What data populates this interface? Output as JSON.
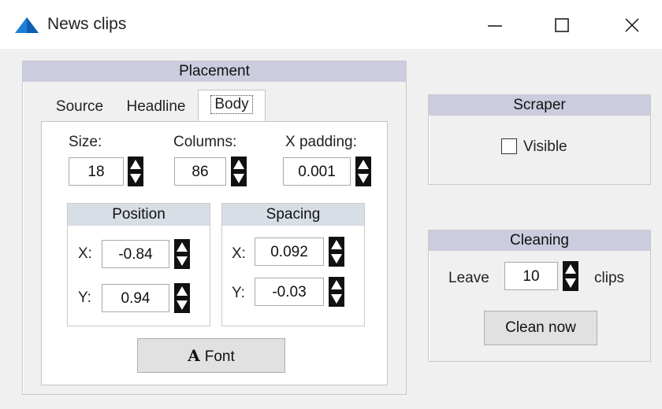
{
  "window": {
    "title": "News clips"
  },
  "placement": {
    "heading": "Placement",
    "tabs": [
      "Source",
      "Headline",
      "Body"
    ],
    "size": {
      "label": "Size:",
      "value": "18"
    },
    "columns": {
      "label": "Columns:",
      "value": "86"
    },
    "x_padding": {
      "label": "X padding:",
      "value": "0.001"
    },
    "position": {
      "heading": "Position",
      "x_label": "X:",
      "x_value": "-0.84",
      "y_label": "Y:",
      "y_value": "0.94"
    },
    "spacing": {
      "heading": "Spacing",
      "x_label": "X:",
      "x_value": "0.092",
      "y_label": "Y:",
      "y_value": "-0.03"
    },
    "font_button": {
      "icon_glyph": "A",
      "label": "Font"
    }
  },
  "scraper": {
    "heading": "Scraper",
    "visible_label": "Visible",
    "visible_checked": false
  },
  "cleaning": {
    "heading": "Cleaning",
    "leave_label": "Leave",
    "leave_value": "10",
    "clips_label": "clips",
    "clean_button": "Clean now"
  },
  "colors": {
    "group_header": "#ccccdf",
    "subgroup_header": "#d8dee6",
    "app_icon": "#1e7fd8"
  }
}
